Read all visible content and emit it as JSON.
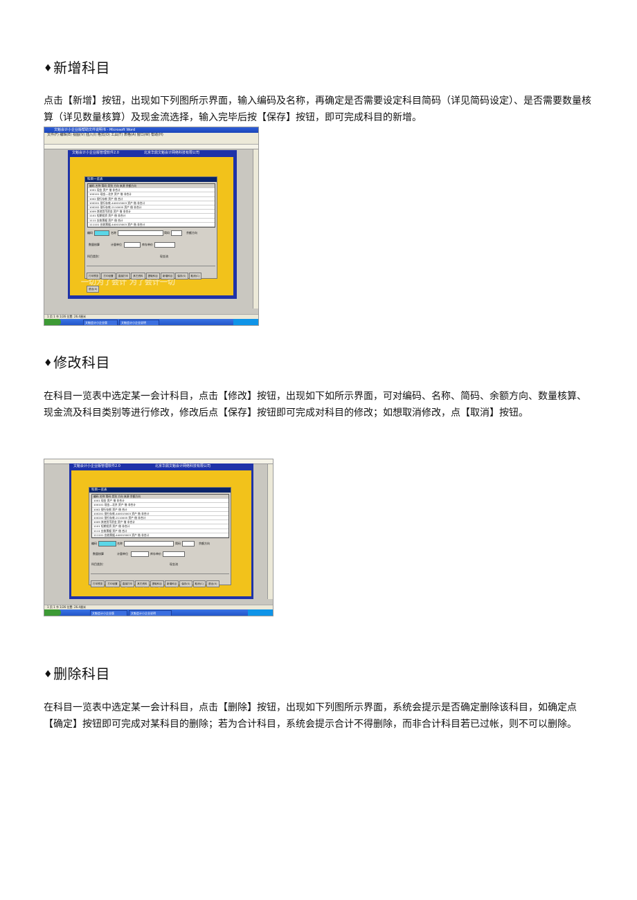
{
  "sections": [
    {
      "heading_marker": "♦",
      "heading": "新增科目",
      "paragraph": "点击【新增】按钮，出现如下列图所示界面，输入编码及名称，再确定是否需要设定科目简码（详见简码设定）、是否需要数量核算（详见数量核算）及现金流选择，输入完毕后按【保存】按钮，即可完成科目的新增。"
    },
    {
      "heading_marker": "♦",
      "heading": "修改科目",
      "paragraph": "在科目一览表中选定某一会计科目，点击【修改】按钮，出现如下如所示界面，可对编码、名称、简码、余额方向、数量核算、现金流及科目类别等进行修改，修改后点【保存】按钮即可完成对科目的修改；如想取消修改，点【取消】按钮。"
    },
    {
      "heading_marker": "♦",
      "heading": "删除科目",
      "paragraph": "在科目一览表中选定某一会计科目，点击【删除】按钮，出现如下列图所示界面，系统会提示是否确定删除该科目，如确定点【确定】按钮即可完成对某科目的删除；若为合计科目，系统会提示合计不得删除，而非合计科目若已过帐，则不可以删除。"
    }
  ],
  "screenshots": {
    "word_title": "文魁会计小企业版帮助文件说明书 - Microsoft Word",
    "word_menu": "文件(F) 编辑(E) 视图(V) 插入(I) 格式(O) 工具(T) 表格(A) 窗口(W) 帮助(H)",
    "app_title_left": "文魁会计小企业版管理软件2.0",
    "app_title_right": "北京华鼎文魁会计网络科技有限公司",
    "dialog_title": "科目一览表",
    "grid_header": "编码   名称   简码  类别 方向 来源 余额方向",
    "grid_rows": [
      "1001   现金   资产  借  非合计",
      "100101 现金—北京   资产  借  非合计",
      "1002   银行存款   资产  借  合计",
      "100201 银行存款-440015003  资产  借  非合计",
      "100202 银行存款-2110005  资产  借  非合计",
      "1009   其他货币资金   资产  借  非合计",
      "1101   短期投资   资产  借  非合计",
      "1111   应收票据   资产  借  合计",
      "111101 应收票据-440015003  资产  借  非合计"
    ],
    "label_code": "编码",
    "label_name": "名称",
    "label_abbr": "简码",
    "label_balance_dir": "余额方向",
    "label_qty": "数量核算",
    "label_unit": "计量单位",
    "label_price": "库存单价",
    "label_category": "科目类别：",
    "label_cashflow": "现金流",
    "buttons": [
      "打印预览",
      "打印设置",
      "直接打印",
      "其它资料",
      "提取科目",
      "新增科目",
      "保存(S)",
      "取消(C)",
      "退出(X)"
    ],
    "watermark": "一切为了会计    为了会计一切",
    "statusbar": "1 页    1 节    1/26    位置: 26.4厘米",
    "taskbar_task1": "文魁会计小企业版",
    "taskbar_task2": "文魁会计小企业说明"
  }
}
